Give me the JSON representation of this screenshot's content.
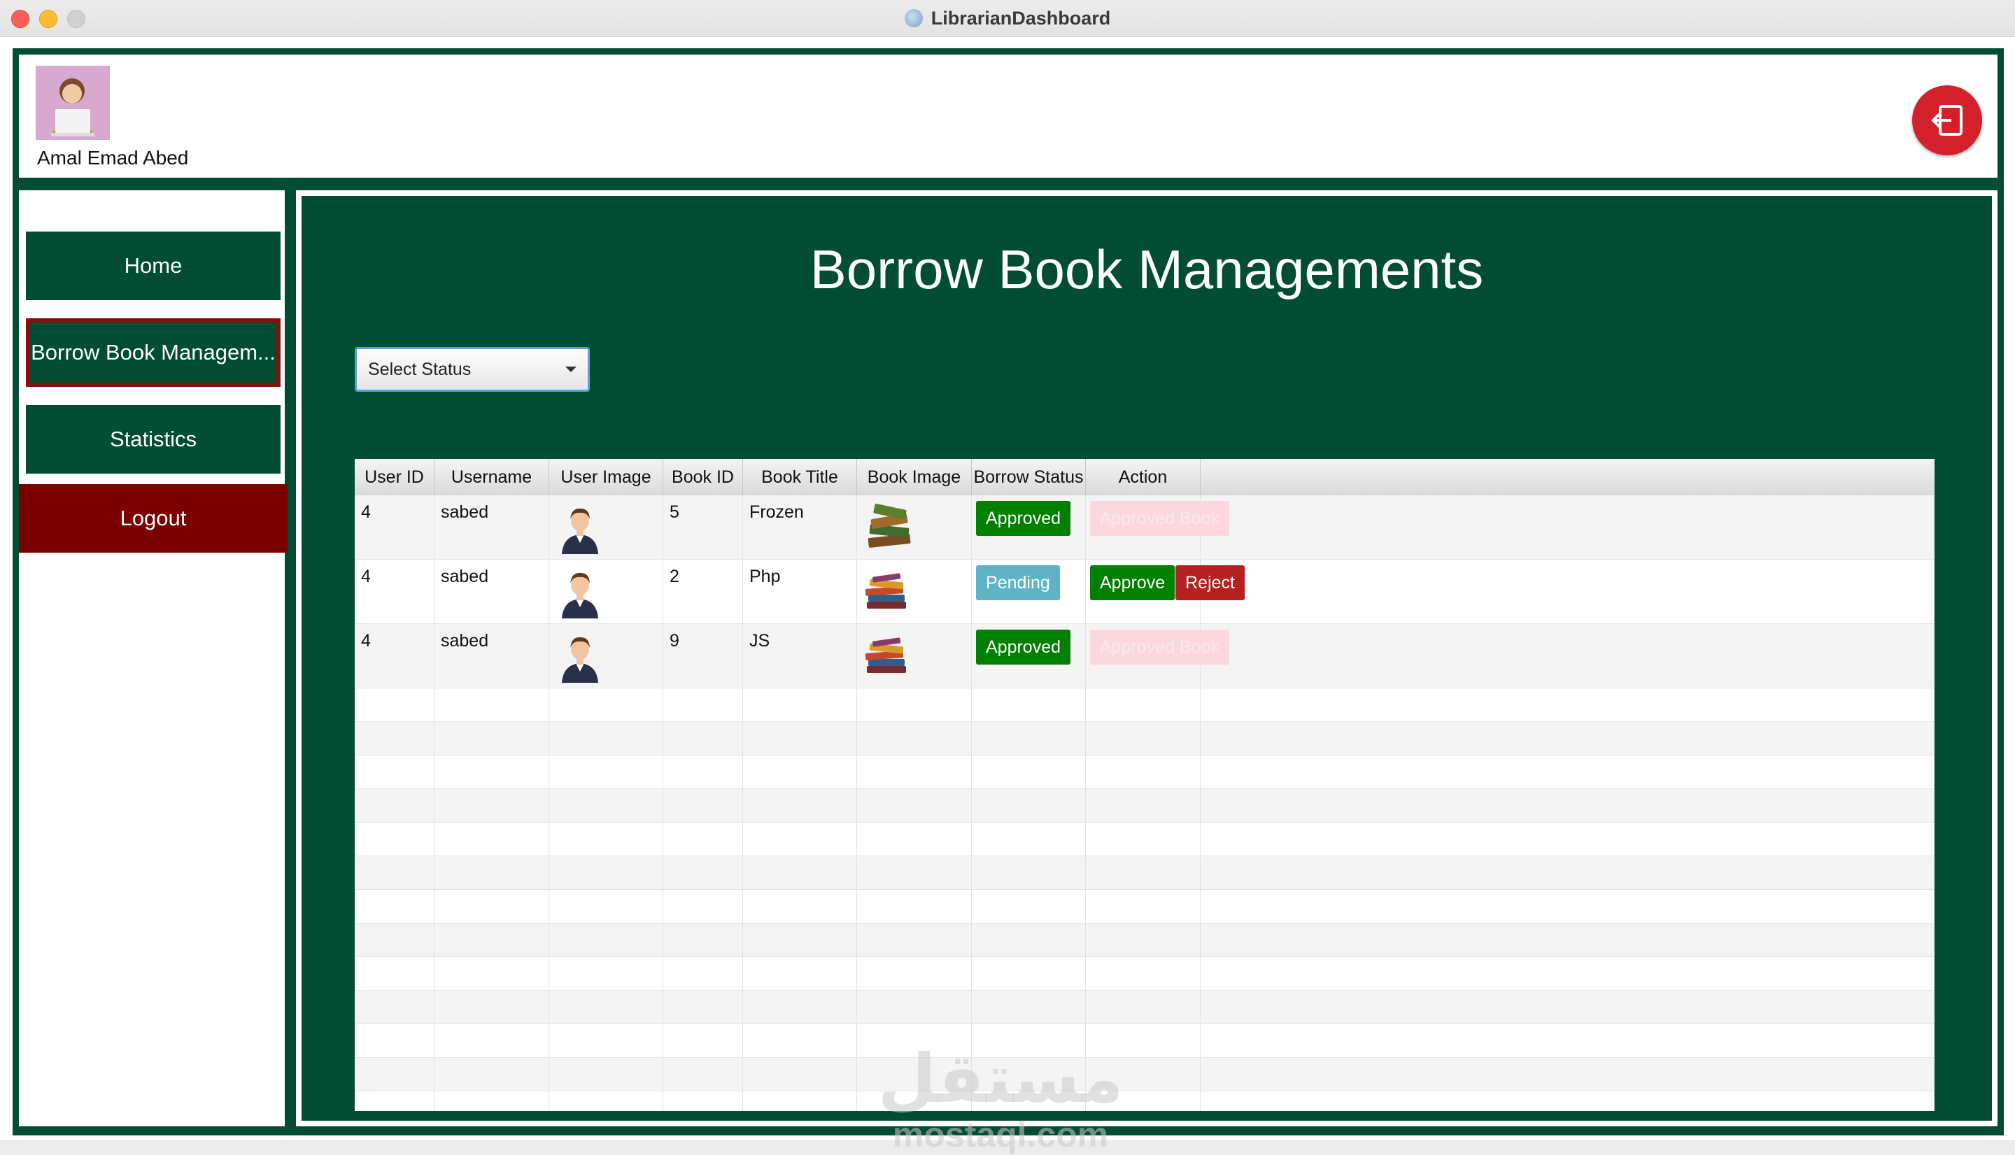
{
  "window": {
    "title": "LibrarianDashboard"
  },
  "header": {
    "user_name": "Amal Emad Abed"
  },
  "sidebar": {
    "items": [
      {
        "label": "Home"
      },
      {
        "label": "Borrow Book Managem..."
      },
      {
        "label": "Statistics"
      },
      {
        "label": "Logout"
      }
    ]
  },
  "main": {
    "title": "Borrow Book Managements",
    "status_filter": {
      "selected": "Select Status"
    },
    "table": {
      "columns": [
        "User ID",
        "Username",
        "User Image",
        "Book ID",
        "Book Title",
        "Book Image",
        "Borrow Status",
        "Action"
      ],
      "rows": [
        {
          "user_id": "4",
          "username": "sabed",
          "book_id": "5",
          "book_title": "Frozen",
          "status": "Approved",
          "action": "Approved Book"
        },
        {
          "user_id": "4",
          "username": "sabed",
          "book_id": "2",
          "book_title": "Php",
          "status": "Pending",
          "approve": "Approve",
          "reject": "Reject"
        },
        {
          "user_id": "4",
          "username": "sabed",
          "book_id": "9",
          "book_title": "JS",
          "status": "Approved",
          "action": "Approved Book"
        }
      ]
    }
  },
  "watermark": {
    "arabic": "مستقل",
    "latin": "mostaql.com"
  },
  "colors": {
    "primary_green": "#004d33",
    "active_border": "#8a0d0d",
    "logout_red": "#7a0000",
    "approved": "#008000",
    "pending": "#5fb3c7",
    "reject": "#b52020"
  }
}
